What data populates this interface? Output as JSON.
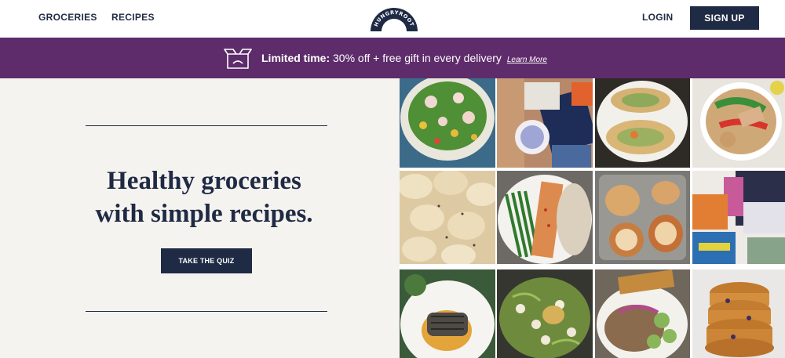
{
  "header": {
    "nav": [
      {
        "label": "GROCERIES"
      },
      {
        "label": "RECIPES"
      }
    ],
    "logo_text": "HUNGRYROOT",
    "login_label": "LOGIN",
    "signup_label": "SIGN UP"
  },
  "promo": {
    "icon": "box-icon",
    "strong_text": "Limited time:",
    "text": "30% off + free gift in every delivery",
    "link_label": "Learn More"
  },
  "hero": {
    "headline_line1": "Healthy groceries",
    "headline_line2": "with simple recipes.",
    "cta_label": "TAKE THE QUIZ"
  },
  "colors": {
    "navy": "#1f2a44",
    "purple": "#5e2c6b",
    "cream": "#f5f3ef"
  },
  "gallery": [
    {
      "name": "salad-bowl-photo"
    },
    {
      "name": "grocery-packages-photo"
    },
    {
      "name": "tacos-photo"
    },
    {
      "name": "chicken-peppers-bowl-photo"
    },
    {
      "name": "pasta-photo"
    },
    {
      "name": "salmon-green-beans-photo"
    },
    {
      "name": "stuffed-buns-photo"
    },
    {
      "name": "grocery-products-photo"
    },
    {
      "name": "grilled-fish-plate-photo"
    },
    {
      "name": "white-bean-greens-photo"
    },
    {
      "name": "grain-bowl-photo"
    },
    {
      "name": "pancakes-photo"
    }
  ]
}
